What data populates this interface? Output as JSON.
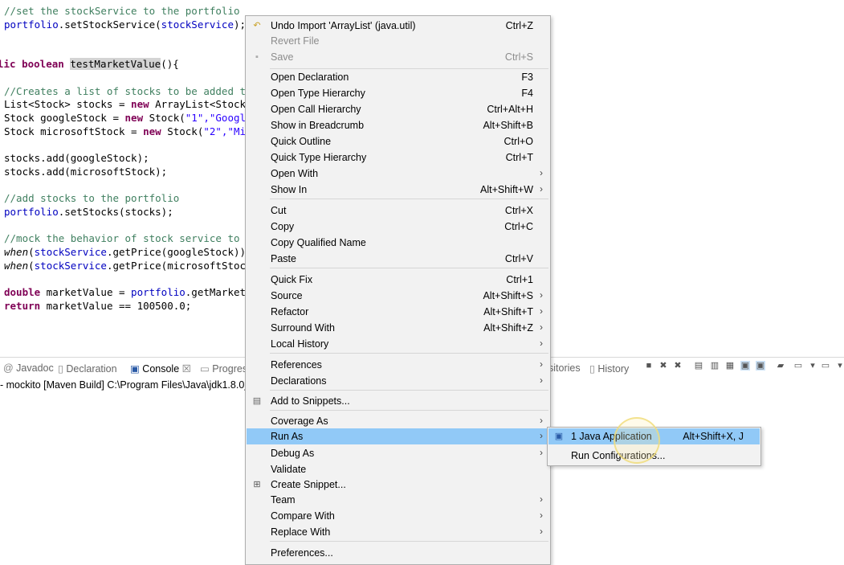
{
  "editor": {
    "lines": {
      "l1": "//set the stockService to the portfolio",
      "l2a": "portfolio",
      "l2b": ".setStockService(",
      "l2c": "stockService",
      "l2d": ");",
      "l3a": "lic boolean ",
      "l3b": "testMarketValue",
      "l3c": "(){",
      "l4": "//Creates a list of stocks to be added t",
      "l5a": "List<Stock> stocks = ",
      "l5b": "new",
      "l5c": " ArrayList<Stock",
      "l6a": "Stock googleStock = ",
      "l6b": "new",
      "l6c": " Stock(",
      "l6d": "\"1\",\"Googl",
      "l7a": "Stock microsoftStock = ",
      "l7b": "new",
      "l7c": " Stock(",
      "l7d": "\"2\",\"Mi",
      "l8": "stocks.add(googleStock);",
      "l9": "stocks.add(microsoftStock);",
      "l10": "//add stocks to the portfolio",
      "l11a": "portfolio",
      "l11b": ".setStocks(stocks);",
      "l12": "//mock the behavior of stock service to",
      "l13a": "when",
      "l13b": "(",
      "l13c": "stockService",
      "l13d": ".getPrice(googleStock))",
      "l14a": "when",
      "l14b": "(",
      "l14c": "stockService",
      "l14d": ".getPrice(microsoftStoc",
      "l15a": "double",
      "l15b": " marketValue = ",
      "l15c": "portfolio",
      "l15d": ".getMarket",
      "l16a": "return",
      "l16b": " marketValue == 100500.0;"
    }
  },
  "panel": {
    "tabs": {
      "javadoc": "Javadoc",
      "declaration": "Declaration",
      "console": "Console",
      "console_close": "☒",
      "progress": "Progres",
      "repositories": "sitories",
      "history": "History"
    },
    "console_line": "- mockito [Maven Build] C:\\Program Files\\Java\\jdk1.8.0_"
  },
  "menu": {
    "items": {
      "undo": {
        "label": "Undo Import 'ArrayList' (java.util)",
        "shortcut": "Ctrl+Z"
      },
      "revert": {
        "label": "Revert File"
      },
      "save": {
        "label": "Save",
        "shortcut": "Ctrl+S"
      },
      "open_declaration": {
        "label": "Open Declaration",
        "shortcut": "F3"
      },
      "open_type_hierarchy": {
        "label": "Open Type Hierarchy",
        "shortcut": "F4"
      },
      "open_call_hierarchy": {
        "label": "Open Call Hierarchy",
        "shortcut": "Ctrl+Alt+H"
      },
      "show_in_breadcrumb": {
        "label": "Show in Breadcrumb",
        "shortcut": "Alt+Shift+B"
      },
      "quick_outline": {
        "label": "Quick Outline",
        "shortcut": "Ctrl+O"
      },
      "quick_type_hierarchy": {
        "label": "Quick Type Hierarchy",
        "shortcut": "Ctrl+T"
      },
      "open_with": {
        "label": "Open With"
      },
      "show_in": {
        "label": "Show In",
        "shortcut": "Alt+Shift+W"
      },
      "cut": {
        "label": "Cut",
        "shortcut": "Ctrl+X"
      },
      "copy": {
        "label": "Copy",
        "shortcut": "Ctrl+C"
      },
      "copy_qualified_name": {
        "label": "Copy Qualified Name"
      },
      "paste": {
        "label": "Paste",
        "shortcut": "Ctrl+V"
      },
      "quick_fix": {
        "label": "Quick Fix",
        "shortcut": "Ctrl+1"
      },
      "source": {
        "label": "Source",
        "shortcut": "Alt+Shift+S"
      },
      "refactor": {
        "label": "Refactor",
        "shortcut": "Alt+Shift+T"
      },
      "surround_with": {
        "label": "Surround With",
        "shortcut": "Alt+Shift+Z"
      },
      "local_history": {
        "label": "Local History"
      },
      "references": {
        "label": "References"
      },
      "declarations": {
        "label": "Declarations"
      },
      "add_to_snippets": {
        "label": "Add to Snippets..."
      },
      "coverage_as": {
        "label": "Coverage As"
      },
      "run_as": {
        "label": "Run As"
      },
      "debug_as": {
        "label": "Debug As"
      },
      "validate": {
        "label": "Validate"
      },
      "create_snippet": {
        "label": "Create Snippet..."
      },
      "team": {
        "label": "Team"
      },
      "compare_with": {
        "label": "Compare With"
      },
      "replace_with": {
        "label": "Replace With"
      },
      "preferences": {
        "label": "Preferences..."
      }
    }
  },
  "submenu": {
    "java_application": {
      "label": "1 Java Application",
      "shortcut": "Alt+Shift+X, J"
    },
    "run_configurations": {
      "label": "Run Configurations..."
    }
  },
  "icons": {
    "undo": "undo-icon",
    "save": "save-icon",
    "snippets": "snippet-icon",
    "create_snippet": "create-snippet-icon",
    "java_app": "java-application-icon"
  },
  "colors": {
    "selection": "#91c9f7",
    "menu_bg": "#f2f2f2",
    "keyword": "#7f0055",
    "comment": "#3f7f5f",
    "string": "#2a00ff",
    "field": "#0000c0"
  }
}
